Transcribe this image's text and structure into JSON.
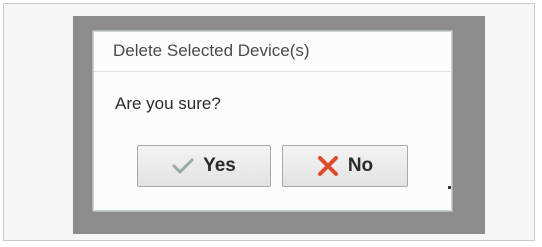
{
  "dialog": {
    "title": "Delete Selected Device(s)",
    "message": "Are you sure?",
    "buttons": {
      "yes": {
        "label": "Yes",
        "icon": "check-icon",
        "icon_color": "#9aa9a3"
      },
      "no": {
        "label": "No",
        "icon": "x-icon",
        "icon_color": "#e04a24"
      }
    }
  },
  "colors": {
    "backdrop": "#8c8c8c",
    "dialog_background": "#fbfdfb",
    "button_border": "#a9a9a9"
  }
}
